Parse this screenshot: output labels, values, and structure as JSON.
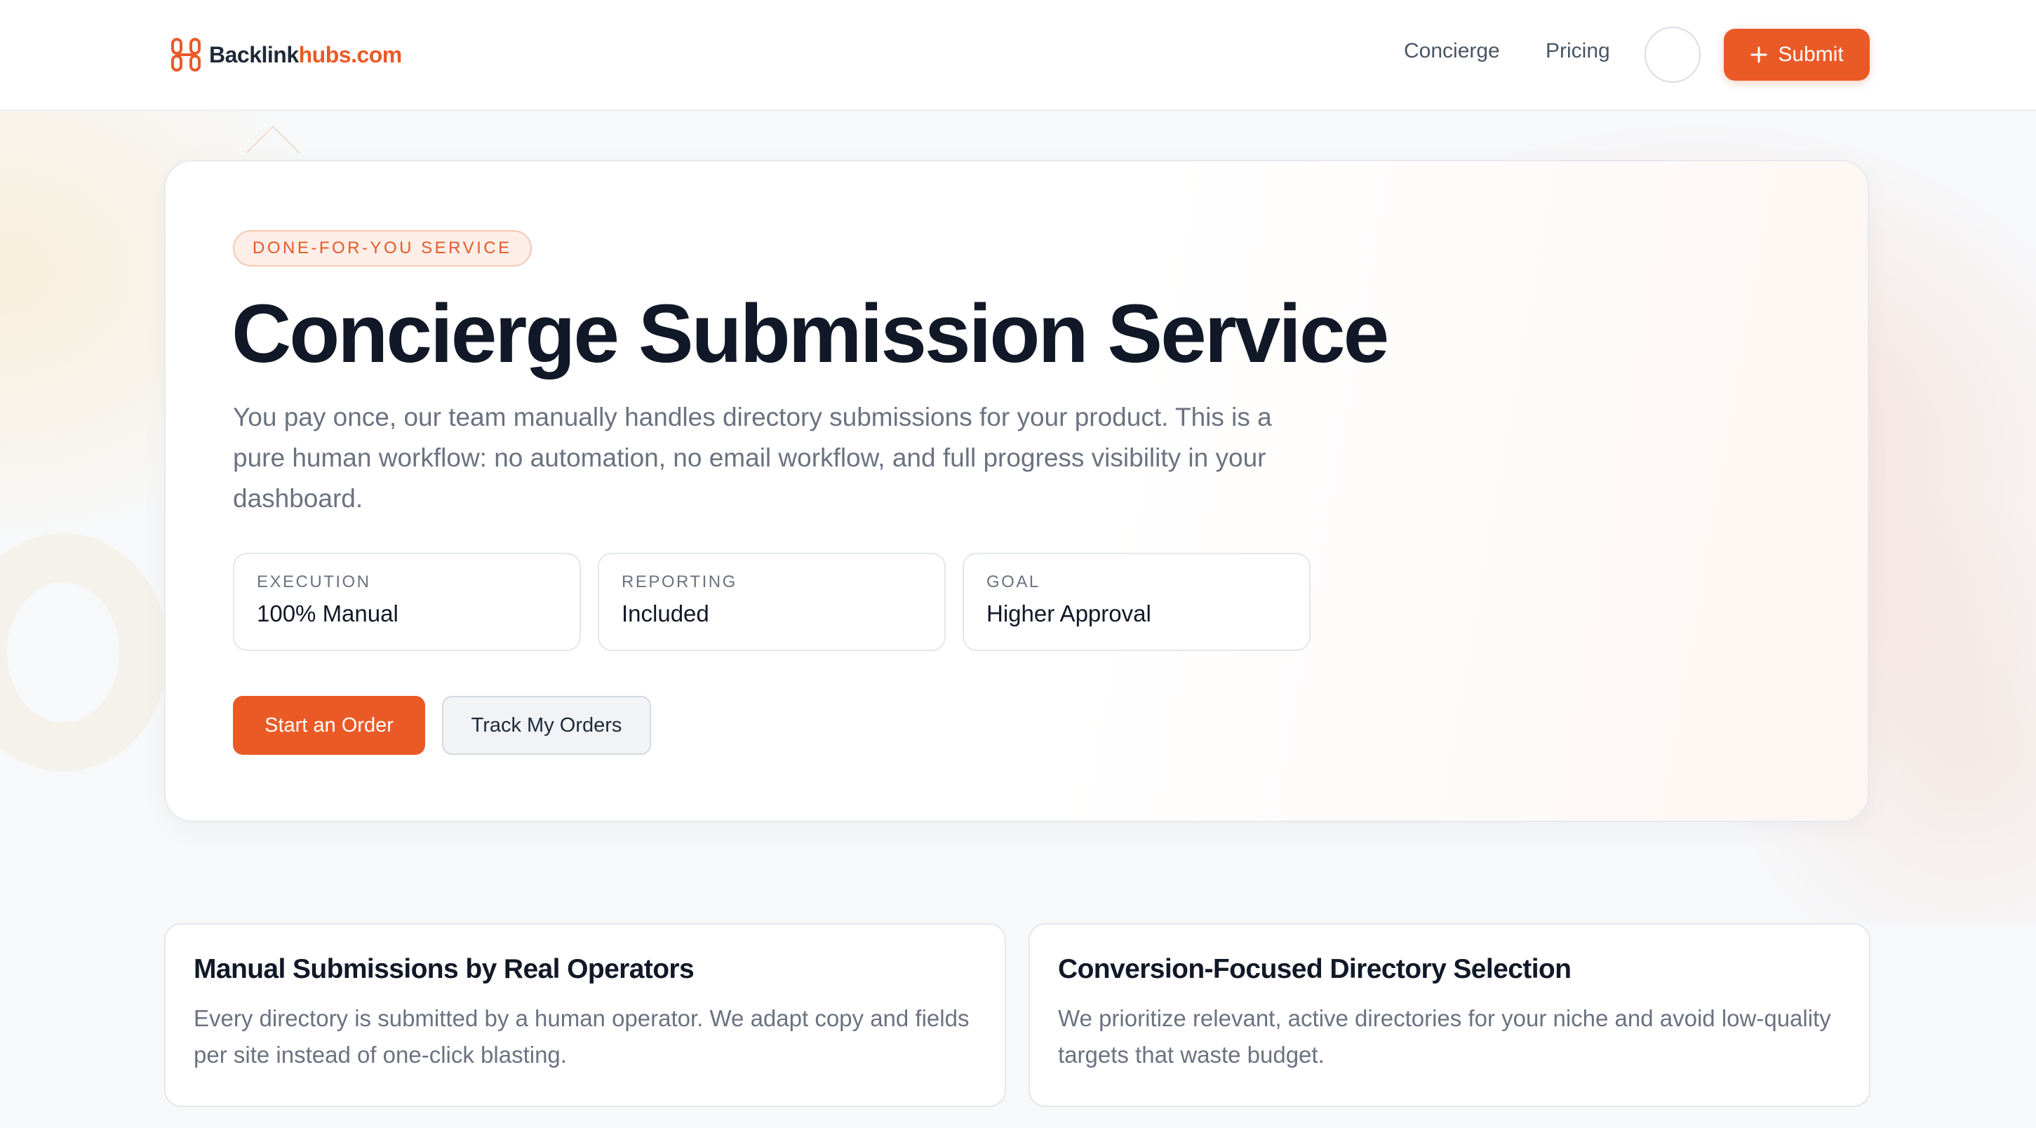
{
  "brand": {
    "name_primary": "Backlink",
    "name_accent": "hubs.com",
    "accent_color": "#ea5a26",
    "logo_icon": "chain-link-icon"
  },
  "nav": {
    "links": [
      {
        "label": "Concierge"
      },
      {
        "label": "Pricing"
      }
    ],
    "submit_label": "Submit",
    "submit_icon": "plus-icon"
  },
  "hero": {
    "badge": "DONE-FOR-YOU SERVICE",
    "title": "Concierge Submission Service",
    "description": "You pay once, our team manually handles directory submissions for your product. This is a pure human workflow: no automation, no email workflow, and full progress visibility in your dashboard.",
    "stats": [
      {
        "label": "EXECUTION",
        "value": "100% Manual"
      },
      {
        "label": "REPORTING",
        "value": "Included"
      },
      {
        "label": "GOAL",
        "value": "Higher Approval"
      }
    ],
    "primary_button": "Start an Order",
    "secondary_button": "Track My Orders"
  },
  "features": [
    {
      "title": "Manual Submissions by Real Operators",
      "description": "Every directory is submitted by a human operator. We adapt copy and fields per site instead of one-click blasting."
    },
    {
      "title": "Conversion-Focused Directory Selection",
      "description": "We prioritize relevant, active directories for your niche and avoid low-quality targets that waste budget."
    }
  ]
}
